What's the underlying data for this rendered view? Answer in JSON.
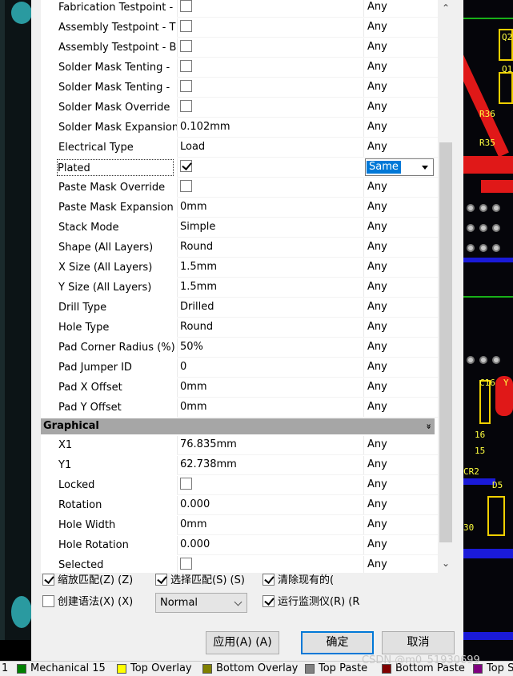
{
  "properties": {
    "rows": [
      {
        "label": "Fabrication Testpoint - ",
        "type": "check",
        "checked": false,
        "any": "Any"
      },
      {
        "label": "Assembly Testpoint - T",
        "type": "check",
        "checked": false,
        "any": "Any"
      },
      {
        "label": "Assembly Testpoint - B",
        "type": "check",
        "checked": false,
        "any": "Any"
      },
      {
        "label": "Solder Mask Tenting - ",
        "type": "check",
        "checked": false,
        "any": "Any"
      },
      {
        "label": "Solder Mask Tenting - ",
        "type": "check",
        "checked": false,
        "any": "Any"
      },
      {
        "label": "Solder Mask Override",
        "type": "check",
        "checked": false,
        "any": "Any"
      },
      {
        "label": "Solder Mask Expansion",
        "type": "text",
        "value": "0.102mm",
        "any": "Any"
      },
      {
        "label": "Electrical Type",
        "type": "text",
        "value": "Load",
        "any": "Any"
      },
      {
        "label": "Plated",
        "type": "check",
        "checked": true,
        "any": "Same",
        "selected": true
      },
      {
        "label": "Paste Mask Override",
        "type": "check",
        "checked": false,
        "any": "Any"
      },
      {
        "label": "Paste Mask Expansion",
        "type": "text",
        "value": "0mm",
        "any": "Any"
      },
      {
        "label": "Stack Mode",
        "type": "text",
        "value": "Simple",
        "any": "Any"
      },
      {
        "label": "Shape (All Layers)",
        "type": "text",
        "value": "Round",
        "any": "Any"
      },
      {
        "label": "X Size (All Layers)",
        "type": "text",
        "value": "1.5mm",
        "any": "Any"
      },
      {
        "label": "Y Size (All Layers)",
        "type": "text",
        "value": "1.5mm",
        "any": "Any"
      },
      {
        "label": "Drill Type",
        "type": "text",
        "value": "Drilled",
        "any": "Any"
      },
      {
        "label": "Hole Type",
        "type": "text",
        "value": "Round",
        "any": "Any"
      },
      {
        "label": "Pad Corner Radius (%)",
        "type": "text",
        "value": "50%",
        "any": "Any"
      },
      {
        "label": "Pad Jumper ID",
        "type": "text",
        "value": "0",
        "any": "Any"
      },
      {
        "label": "Pad X Offset",
        "type": "text",
        "value": "0mm",
        "any": "Any"
      },
      {
        "label": "Pad Y Offset",
        "type": "text",
        "value": "0mm",
        "any": "Any"
      }
    ],
    "section_graphical": "Graphical",
    "graphical_rows": [
      {
        "label": "X1",
        "type": "text",
        "value": "76.835mm",
        "any": "Any"
      },
      {
        "label": "Y1",
        "type": "text",
        "value": "62.738mm",
        "any": "Any"
      },
      {
        "label": "Locked",
        "type": "check",
        "checked": false,
        "any": "Any"
      },
      {
        "label": "Rotation",
        "type": "text",
        "value": "0.000",
        "any": "Any"
      },
      {
        "label": "Hole Width",
        "type": "text",
        "value": "0mm",
        "any": "Any"
      },
      {
        "label": "Hole Rotation",
        "type": "text",
        "value": "0.000",
        "any": "Any"
      },
      {
        "label": "Selected",
        "type": "check",
        "checked": false,
        "any": "Any"
      }
    ]
  },
  "options": {
    "zoom_match": "缩放匹配(Z) (Z)",
    "select_match": "选择匹配(S) (S)",
    "clear_existing": "清除现有的(",
    "create_expression": "创建语法(X) (X)",
    "mode_select": "Normal",
    "run_inspector": "运行监测仪(R) (R"
  },
  "buttons": {
    "apply": "应用(A) (A)",
    "ok": "确定",
    "cancel": "取消"
  },
  "statusbar": {
    "layers": [
      {
        "name": "1",
        "color": ""
      },
      {
        "name": "Mechanical 15",
        "color": "#008000"
      },
      {
        "name": "Top Overlay",
        "color": "#ffff00"
      },
      {
        "name": "Bottom Overlay",
        "color": "#808000"
      },
      {
        "name": "Top Paste",
        "color": "#808080"
      },
      {
        "name": "Bottom Paste",
        "color": "#800000"
      },
      {
        "name": "Top S",
        "color": "#800080"
      }
    ],
    "watermark": "CSDN @m0_51930699"
  },
  "pcb_labels": [
    "R36",
    "R35",
    "C16",
    "16",
    "15",
    "CR2",
    "D5",
    "30",
    "Q2",
    "Q1",
    "Y"
  ]
}
